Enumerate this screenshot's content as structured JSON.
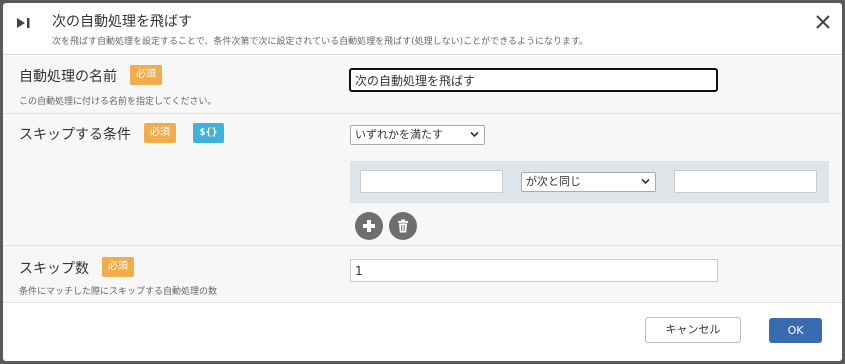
{
  "dialog": {
    "title": "次の自動処理を飛ばす",
    "description": "次を飛ばす自動処理を設定することで、条件次第で次に設定されている自動処理を飛ばす(処理しない)ことができるようになります。",
    "icon": "skip-next-icon",
    "close_icon": "close-icon"
  },
  "fields": {
    "name": {
      "label": "自動処理の名前",
      "required_badge": "必須",
      "hint": "この自動処理に付ける名前を指定してください。",
      "value": "次の自動処理を飛ばす"
    },
    "condition": {
      "label": "スキップする条件",
      "required_badge": "必須",
      "variable_badge": "${}",
      "match_mode": "いずれかを満たす",
      "row": {
        "left_value": "",
        "operator": "が次と同じ",
        "right_value": ""
      },
      "add_icon": "plus-icon",
      "delete_icon": "trash-icon"
    },
    "skip_count": {
      "label": "スキップ数",
      "required_badge": "必須",
      "hint": "条件にマッチした際にスキップする自動処理の数",
      "value": "1"
    }
  },
  "footer": {
    "cancel_label": "キャンセル",
    "ok_label": "OK"
  },
  "colors": {
    "required_badge": "#f0ad4e",
    "variable_badge": "#3fb2d9",
    "ok_button": "#3a6bb0",
    "condition_box": "#dde5ea"
  }
}
